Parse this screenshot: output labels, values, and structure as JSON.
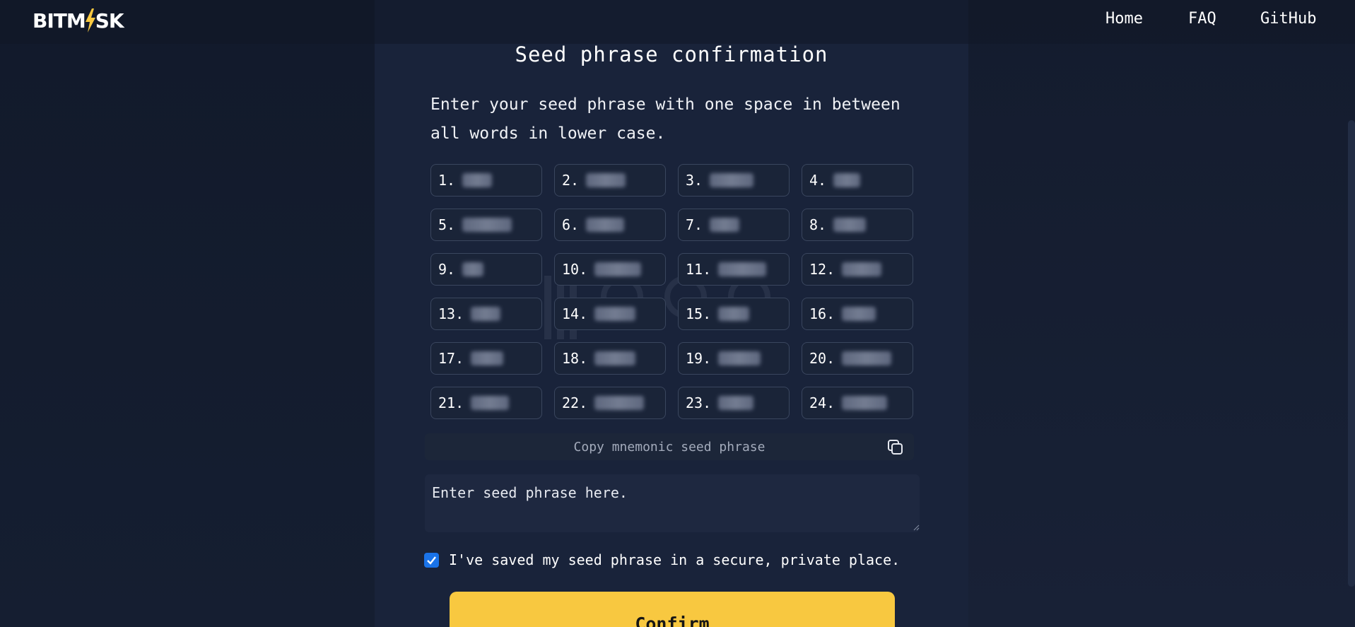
{
  "header": {
    "logo_text_left": "BITM",
    "logo_text_right": "SK",
    "nav": [
      "Home",
      "FAQ",
      "GitHub"
    ]
  },
  "page": {
    "title": "Seed phrase confirmation",
    "intro": "Enter your seed phrase with one space in between all words in lower case."
  },
  "words": [
    {
      "label": "1.",
      "value": ""
    },
    {
      "label": "2.",
      "value": ""
    },
    {
      "label": "3.",
      "value": ""
    },
    {
      "label": "4.",
      "value": ""
    },
    {
      "label": "5.",
      "value": ""
    },
    {
      "label": "6.",
      "value": ""
    },
    {
      "label": "7.",
      "value": ""
    },
    {
      "label": "8.",
      "value": ""
    },
    {
      "label": "9.",
      "value": ""
    },
    {
      "label": "10.",
      "value": ""
    },
    {
      "label": "11.",
      "value": ""
    },
    {
      "label": "12.",
      "value": ""
    },
    {
      "label": "13.",
      "value": ""
    },
    {
      "label": "14.",
      "value": ""
    },
    {
      "label": "15.",
      "value": ""
    },
    {
      "label": "16.",
      "value": ""
    },
    {
      "label": "17.",
      "value": ""
    },
    {
      "label": "18.",
      "value": ""
    },
    {
      "label": "19.",
      "value": ""
    },
    {
      "label": "20.",
      "value": ""
    },
    {
      "label": "21.",
      "value": ""
    },
    {
      "label": "22.",
      "value": ""
    },
    {
      "label": "23.",
      "value": ""
    },
    {
      "label": "24.",
      "value": ""
    }
  ],
  "copy_bar": {
    "label": "Copy mnemonic seed phrase",
    "icon": "copy-icon"
  },
  "seed_input": {
    "placeholder": "Enter seed phrase here.",
    "value": ""
  },
  "checkbox": {
    "label": "I've saved my seed phrase in a secure, private place.",
    "checked": true
  },
  "confirm_button": {
    "label": "Confirm"
  },
  "colors": {
    "accent": "#f8c840",
    "checkbox": "#1a73e8",
    "background": "#19233a"
  }
}
